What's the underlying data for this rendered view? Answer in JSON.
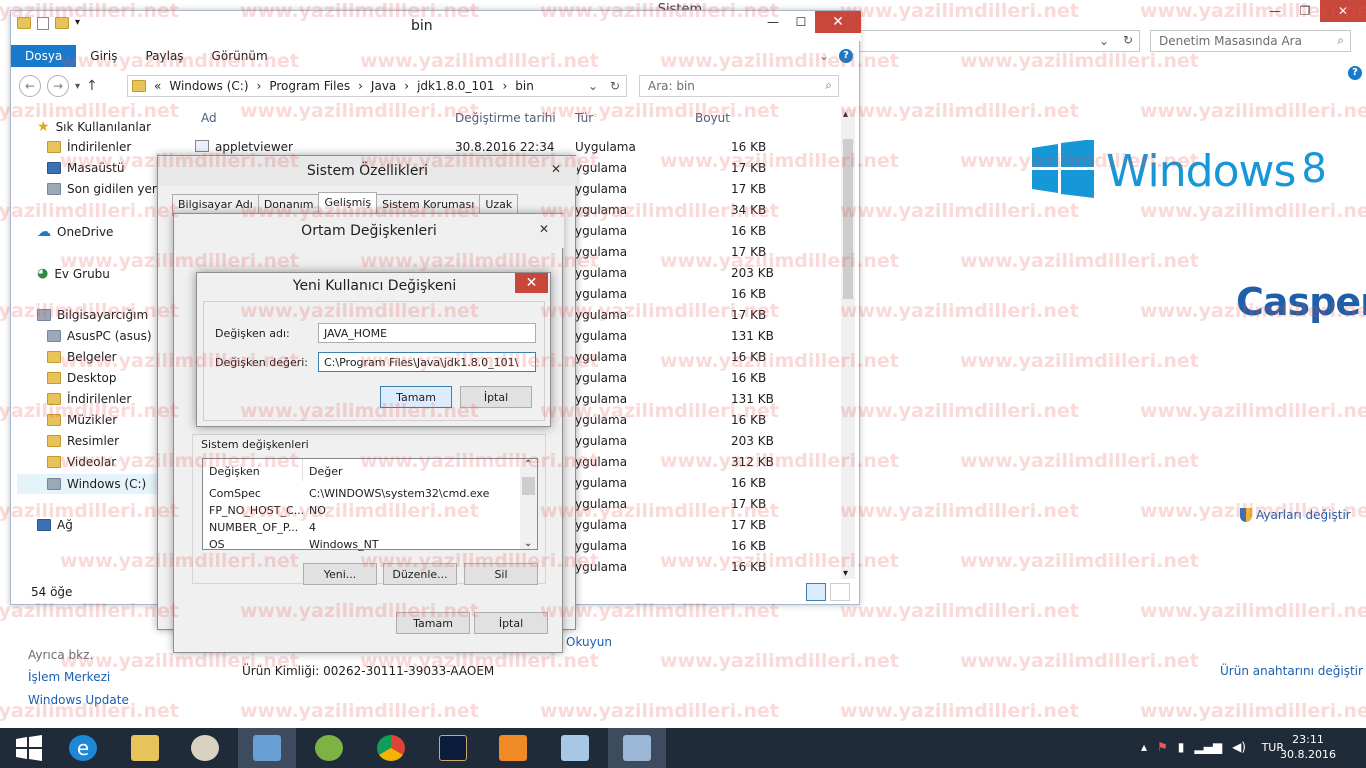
{
  "background_window": {
    "title": "Sistem",
    "search_placeholder": "Denetim Masasında Ara",
    "windows_logo_text": "Windows",
    "windows_version": "8",
    "brand": "Casper",
    "change_settings": "Ayarları değiştir",
    "see_also": "Ayrıca bkz.",
    "action_center": "İşlem Merkezi",
    "windows_update": "Windows Update",
    "read": "Okuyun",
    "product_id": "Ürün Kimliği:  00262-30111-39033-AAOEM",
    "change_product_key": "Ürün anahtarını değiştir"
  },
  "explorer": {
    "title": "bin",
    "ribbon_tabs": [
      "Dosya",
      "Giriş",
      "Paylaş",
      "Görünüm"
    ],
    "breadcrumb": [
      "Windows (C:)",
      "Program Files",
      "Java",
      "jdk1.8.0_101",
      "bin"
    ],
    "search_placeholder": "Ara: bin",
    "nav": {
      "favorites": "Sık Kullanılanlar",
      "downloads": "İndirilenler",
      "desktop": "Masaüstü",
      "recent": "Son gidilen yerler",
      "onedrive": "OneDrive",
      "homegroup": "Ev Grubu",
      "computer": "Bilgisayarcığım",
      "asuspc": "AsusPC (asus)",
      "documents": "Belgeler",
      "desktop2": "Desktop",
      "downloads2": "İndirilenler",
      "music": "Müzikler",
      "pictures": "Resimler",
      "videos": "Videolar",
      "windows_c": "Windows (C:)",
      "network": "Ağ"
    },
    "columns": {
      "name": "Ad",
      "date": "Değiştirme tarihi",
      "type": "Tür",
      "size": "Boyut"
    },
    "first_file": {
      "name": "appletviewer",
      "date": "30.8.2016 22:34",
      "type": "Uygulama",
      "size": "16 KB"
    },
    "types_visible": "ygulama",
    "sizes": [
      "17 KB",
      "17 KB",
      "34 KB",
      "16 KB",
      "17 KB",
      "203 KB",
      "16 KB",
      "17 KB",
      "131 KB",
      "16 KB",
      "16 KB",
      "131 KB",
      "16 KB",
      "203 KB",
      "312 KB",
      "16 KB",
      "17 KB",
      "17 KB",
      "16 KB",
      "16 KB"
    ],
    "status": "54 öğe"
  },
  "system_properties": {
    "title": "Sistem Özellikleri",
    "tabs": [
      "Bilgisayar Adı",
      "Donanım",
      "Gelişmiş",
      "Sistem Koruması",
      "Uzak"
    ]
  },
  "env_vars": {
    "title": "Ortam Değişkenleri",
    "system_vars_label": "Sistem değişkenleri",
    "col_var": "Değişken",
    "col_val": "Değer",
    "rows": [
      {
        "name": "ComSpec",
        "value": "C:\\WINDOWS\\system32\\cmd.exe"
      },
      {
        "name": "FP_NO_HOST_C...",
        "value": "NO"
      },
      {
        "name": "NUMBER_OF_P...",
        "value": "4"
      },
      {
        "name": "OS",
        "value": "Windows_NT"
      }
    ],
    "btn_new": "Yeni...",
    "btn_edit": "Düzenle...",
    "btn_delete": "Sil",
    "btn_ok": "Tamam",
    "btn_cancel": "İptal"
  },
  "new_var": {
    "title": "Yeni Kullanıcı Değişkeni",
    "name_label": "Değişken adı:",
    "name_value": "JAVA_HOME",
    "value_label": "Değişken değeri:",
    "value_value": "C:\\Program Files\\Java\\jdk1.8.0_101\\",
    "ok": "Tamam",
    "cancel": "İptal"
  },
  "taskbar": {
    "lang": "TUR",
    "time": "23:11",
    "date": "30.8.2016"
  },
  "watermark": "www.yazilimdilleri.net",
  "colors": {
    "accent": "#1979ca",
    "close": "#c7473b",
    "taskbar": "#202b3a",
    "win8_blue": "#1597d8"
  }
}
